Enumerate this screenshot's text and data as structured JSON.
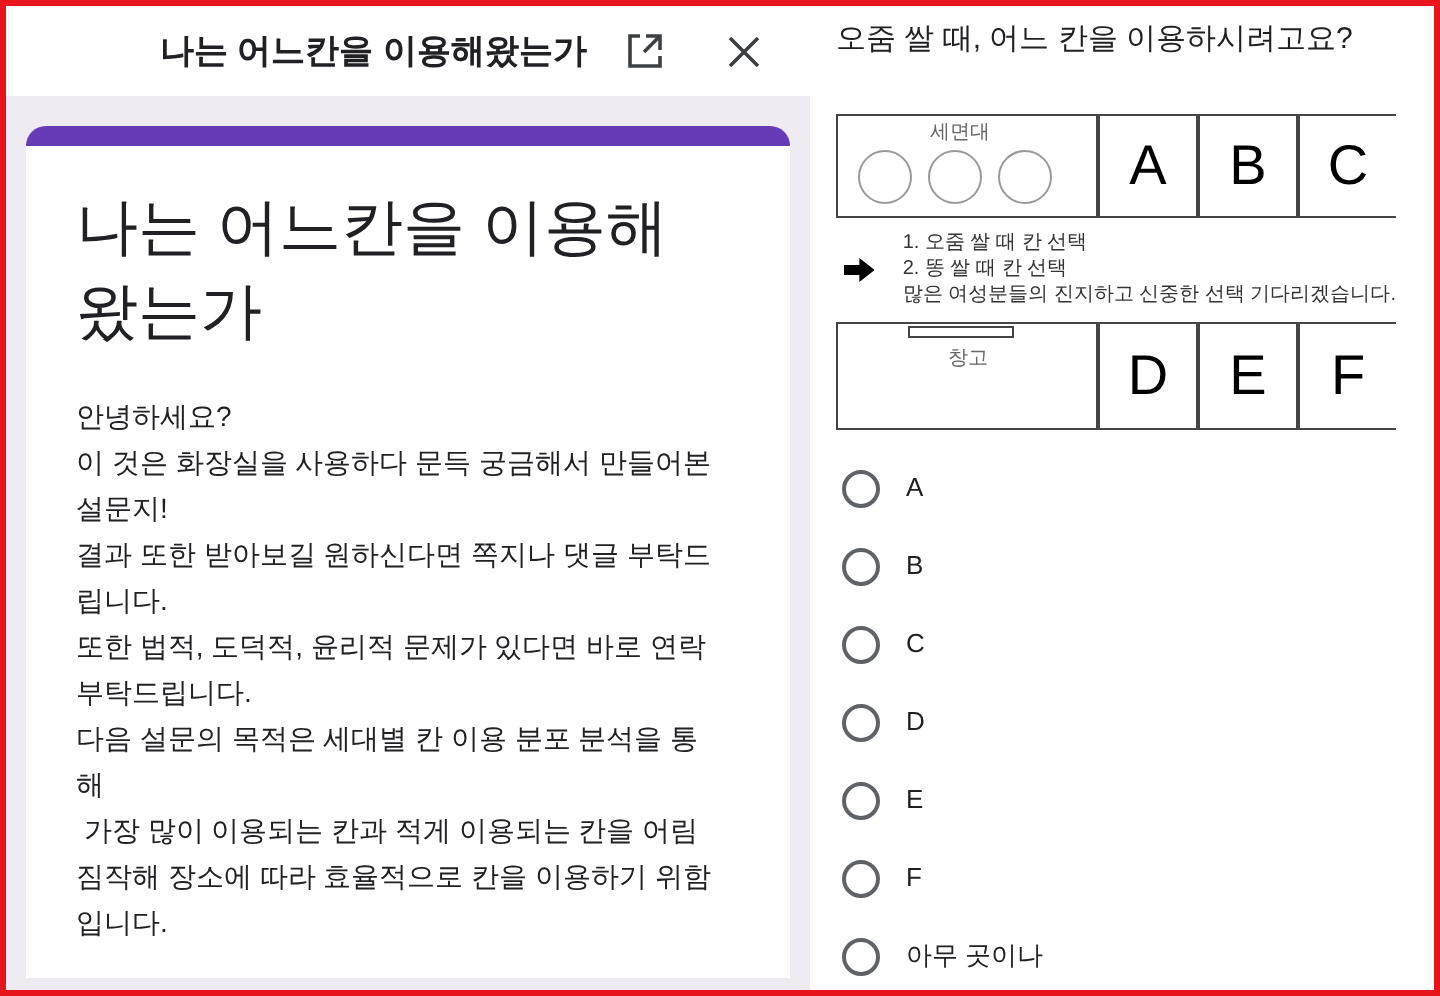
{
  "header": {
    "title": "나는 어느칸을 이용해왔는가"
  },
  "form": {
    "title": "나는 어느칸을 이용해 왔는가",
    "description": [
      "안녕하세요?",
      "이 것은 화장실을 사용하다 문득 궁금해서 만들어본 설문지!",
      "결과 또한 받아보길 원하신다면 쪽지나 댓글 부탁드립니다.",
      "또한 법적, 도덕적, 윤리적 문제가 있다면 바로 연락 부탁드립니다.",
      "다음 설문의 목적은 세대별 칸 이용 분포 분석을 통해",
      " 가장 많이 이용되는 칸과 적게 이용되는 칸을 어림짐작해 장소에 따라 효율적으로 칸을 이용하기 위함입니다."
    ]
  },
  "question": {
    "title": "오줌 쌀 때, 어느 칸을 이용하시려고요?",
    "diagram": {
      "top_area_label": "세면대",
      "top_stalls": [
        "A",
        "B",
        "C"
      ],
      "notes": [
        "1. 오줌 쌀 때 칸 선택",
        "2. 똥 쌀 때 칸 선택",
        "많은 여성분들의 진지하고 신중한 선택 기다리겠습니다."
      ],
      "bottom_area_label": "창고",
      "bottom_stalls": [
        "D",
        "E",
        "F"
      ]
    },
    "options": [
      {
        "label": "A",
        "selected": false
      },
      {
        "label": "B",
        "selected": false
      },
      {
        "label": "C",
        "selected": false
      },
      {
        "label": "D",
        "selected": false
      },
      {
        "label": "E",
        "selected": false
      },
      {
        "label": "F",
        "selected": false
      },
      {
        "label": "아무 곳이나",
        "selected": false
      }
    ]
  }
}
